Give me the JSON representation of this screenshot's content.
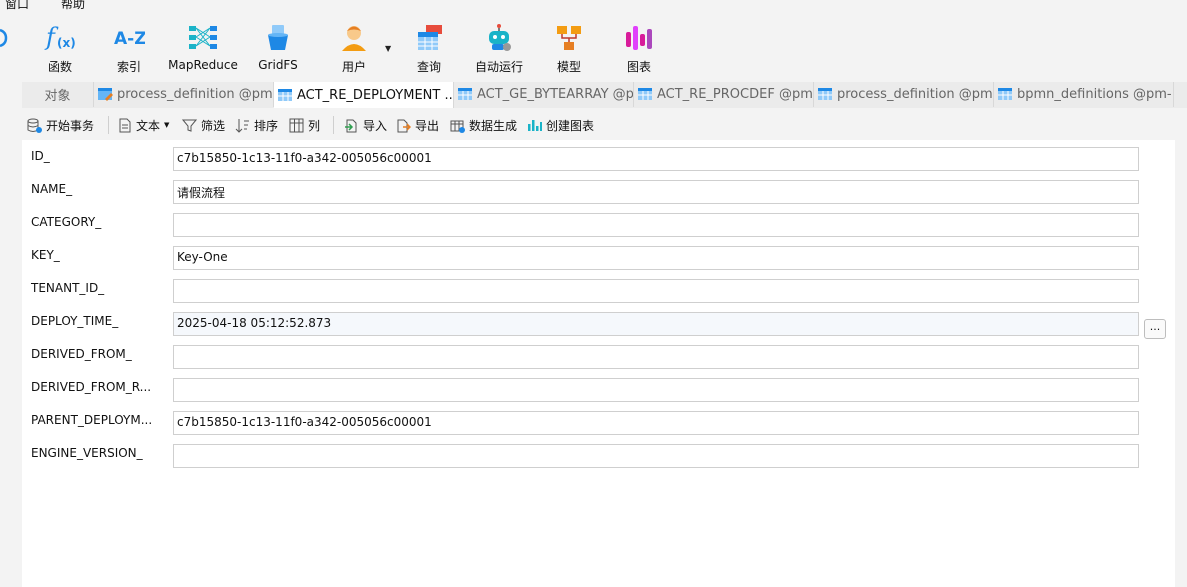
{
  "menu": {
    "window": "窗口",
    "help": "帮助"
  },
  "ribbon": [
    {
      "name": "function",
      "label": "函数"
    },
    {
      "name": "index",
      "label": "索引"
    },
    {
      "name": "mapreduce",
      "label": "MapReduce"
    },
    {
      "name": "gridfs",
      "label": "GridFS"
    },
    {
      "name": "user",
      "label": "用户"
    },
    {
      "name": "query",
      "label": "查询"
    },
    {
      "name": "automation",
      "label": "自动运行"
    },
    {
      "name": "model",
      "label": "模型"
    },
    {
      "name": "chart",
      "label": "图表"
    }
  ],
  "tabs": {
    "objects": "对象",
    "items": [
      {
        "label": "process_definition @pm..."
      },
      {
        "label": "ACT_RE_DEPLOYMENT ..."
      },
      {
        "label": "ACT_GE_BYTEARRAY @p..."
      },
      {
        "label": "ACT_RE_PROCDEF @pm-..."
      },
      {
        "label": "process_definition @pm..."
      },
      {
        "label": "bpmn_definitions @pm-..."
      }
    ]
  },
  "subtoolbar": {
    "begin_transaction": "开始事务",
    "text": "文本",
    "filter": "筛选",
    "sort": "排序",
    "columns": "列",
    "import": "导入",
    "export": "导出",
    "generate_data": "数据生成",
    "create_chart": "创建图表"
  },
  "form": {
    "fields": [
      {
        "label": "ID_",
        "value": "c7b15850-1c13-11f0-a342-005056c00001"
      },
      {
        "label": "NAME_",
        "value": "请假流程"
      },
      {
        "label": "CATEGORY_",
        "value": ""
      },
      {
        "label": "KEY_",
        "value": "Key-One"
      },
      {
        "label": "TENANT_ID_",
        "value": ""
      },
      {
        "label": "DEPLOY_TIME_",
        "value": "2025-04-18 05:12:52.873"
      },
      {
        "label": "DERIVED_FROM_",
        "value": ""
      },
      {
        "label": "DERIVED_FROM_R...",
        "value": ""
      },
      {
        "label": "PARENT_DEPLOYM...",
        "value": "c7b15850-1c13-11f0-a342-005056c00001"
      },
      {
        "label": "ENGINE_VERSION_",
        "value": ""
      }
    ],
    "ellipsis_label": "..."
  },
  "colors": {
    "accent": "#1e88e5",
    "chart_pink": "#d81b9a",
    "model_orange": "#f39c12"
  }
}
